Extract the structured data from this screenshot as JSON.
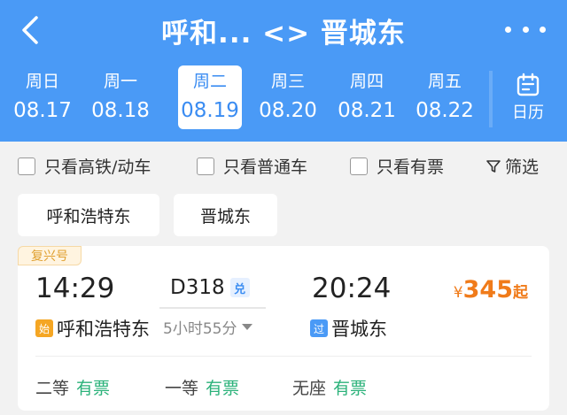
{
  "header": {
    "title": "呼和... <> 晋城东",
    "calendar_label": "日历"
  },
  "dates": [
    {
      "weekday": "周日",
      "date": "08.17"
    },
    {
      "weekday": "周一",
      "date": "08.18"
    },
    {
      "weekday": "周二",
      "date": "08.19",
      "selected": true
    },
    {
      "weekday": "周三",
      "date": "08.20"
    },
    {
      "weekday": "周四",
      "date": "08.21"
    },
    {
      "weekday": "周五",
      "date": "08.22"
    }
  ],
  "filters": {
    "high_speed": "只看高铁/动车",
    "normal": "只看普通车",
    "available": "只看有票",
    "screen": "筛选"
  },
  "stations": {
    "from": "呼和浩特东",
    "to": "晋城东"
  },
  "train": {
    "badge": "复兴号",
    "dep_time": "14:29",
    "arr_time": "20:24",
    "number": "D318",
    "exchange_tag": "兑",
    "duration": "5小时55分",
    "dep_tag": "始",
    "dep_station": "呼和浩特东",
    "arr_tag": "过",
    "arr_station": "晋城东",
    "price_currency": "¥",
    "price": "345",
    "price_suffix": "起",
    "seats": [
      {
        "type": "二等",
        "status": "有票"
      },
      {
        "type": "一等",
        "status": "有票"
      },
      {
        "type": "无座",
        "status": "有票"
      }
    ]
  },
  "colors": {
    "header_bg": "#4a9af6",
    "accent_blue": "#3a8cf2",
    "price_orange": "#f07b1a",
    "available_green": "#2bb27a",
    "start_tag": "#f5a623",
    "pass_tag": "#4a9af6"
  }
}
